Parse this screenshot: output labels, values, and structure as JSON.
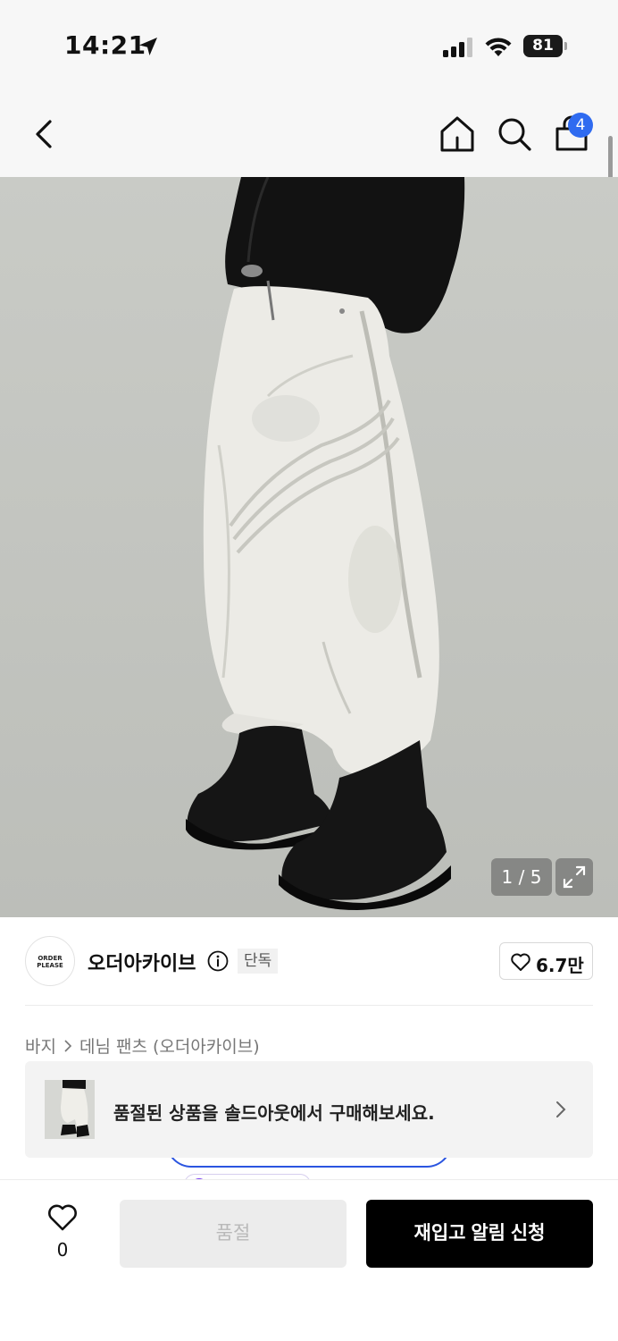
{
  "status_bar": {
    "time": "14:21",
    "battery": "81"
  },
  "navbar": {
    "cart_count": "4"
  },
  "product_image": {
    "counter": "1 / 5"
  },
  "brand": {
    "logo_text": "ORDER PLEASE",
    "name": "오더아카이브",
    "exclusive_label": "단독",
    "like_count": "6.7만"
  },
  "breadcrumb": {
    "items": [
      "바지",
      "데님 팬츠 (오더아카이브)"
    ]
  },
  "soldout_banner": {
    "text": "품절된 상품을 솔드아웃에서 구매해보세요."
  },
  "bottom_bar": {
    "wish_count": "0",
    "soldout_label": "품절",
    "restock_label": "재입고 알림 신청"
  },
  "colors": {
    "accent_blue": "#2f6bf0",
    "primary_button": "#000000",
    "disabled_button": "#ececec"
  }
}
